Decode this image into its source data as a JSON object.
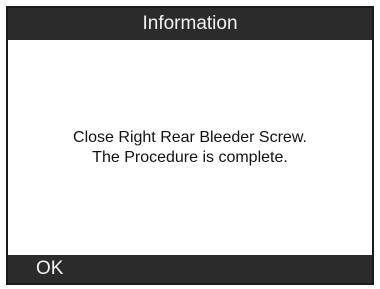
{
  "dialog": {
    "title": "Information",
    "message_lines": [
      "Close Right Rear Bleeder Screw.",
      "The Procedure is complete."
    ]
  },
  "soft_keys": {
    "ok_label": "OK"
  },
  "colors": {
    "bar_background": "#2b2b2b",
    "bar_text": "#f2f2f2",
    "content_background": "#ffffff",
    "content_text": "#111111"
  }
}
